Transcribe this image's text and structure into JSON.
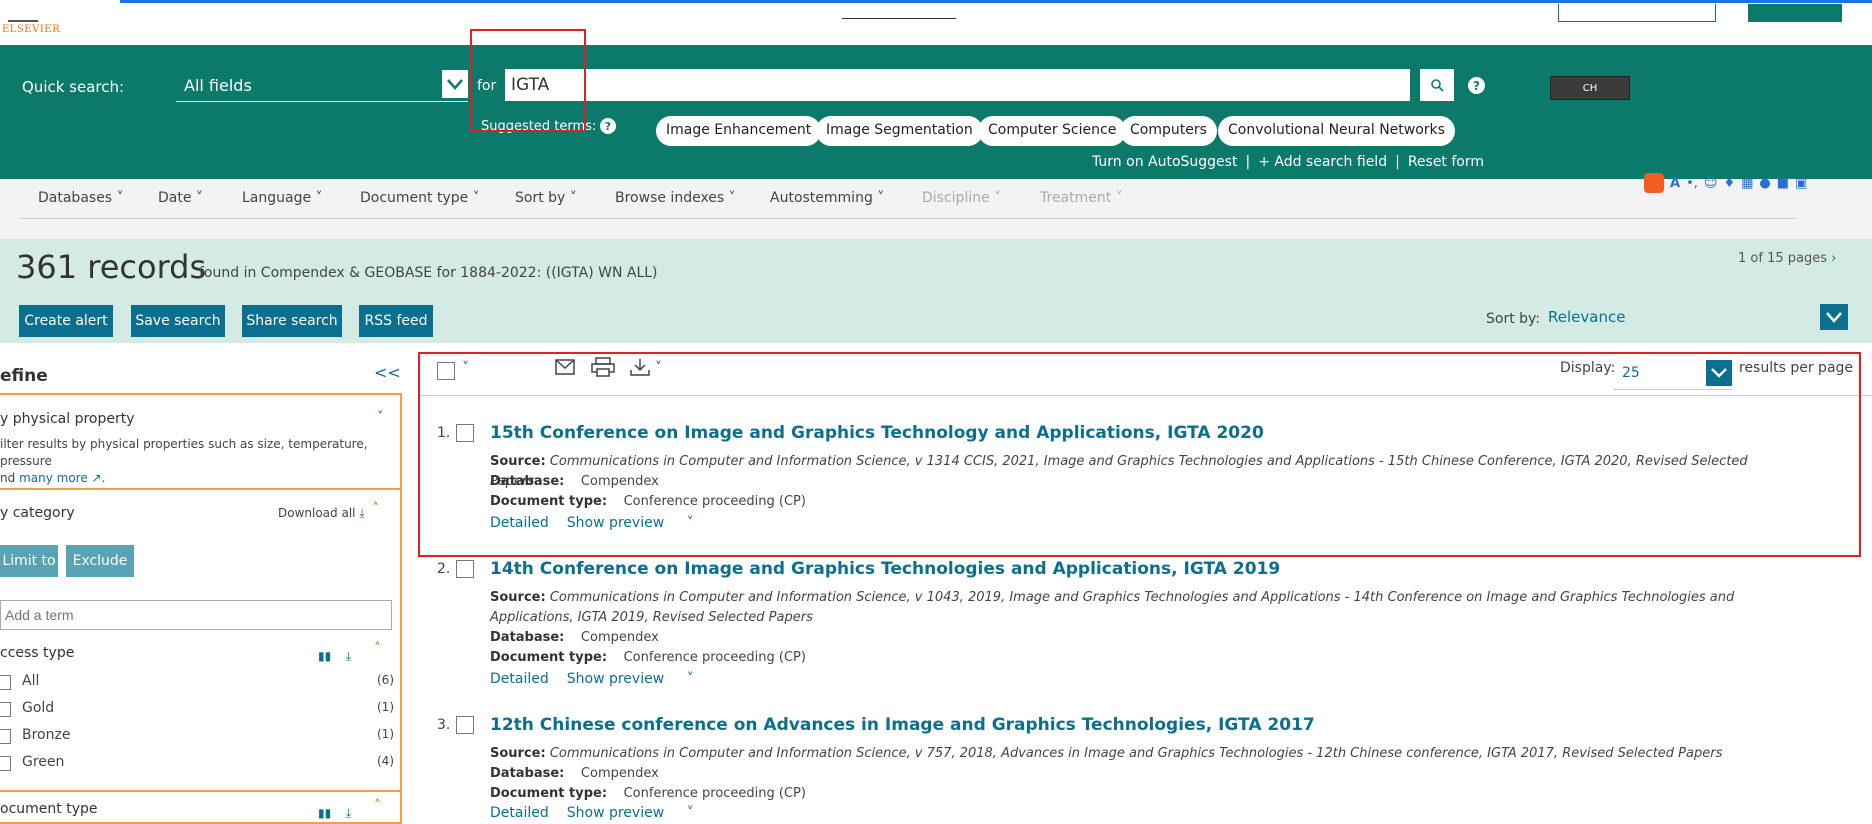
{
  "logo": {
    "text": "ELSEVIER"
  },
  "quick_search": {
    "label": "Quick search:",
    "field": "All fields",
    "for_label": "for",
    "query": "IGTA",
    "help": "?"
  },
  "suggested": {
    "label": "Suggested terms:",
    "terms": [
      "Image Enhancement",
      "Image Segmentation",
      "Computer Science",
      "Computers",
      "Convolutional Neural Networks"
    ]
  },
  "search_links": {
    "autosuggest": "Turn on AutoSuggest",
    "sep": "|",
    "add_field": "+ Add search field",
    "reset": "Reset form"
  },
  "ime_widget": {
    "label": "CH"
  },
  "nav": {
    "items": [
      "Databases",
      "Date",
      "Language",
      "Document type",
      "Sort by",
      "Browse indexes",
      "Autostemming"
    ],
    "disabled": [
      "Discipline",
      "Treatment"
    ]
  },
  "results_header": {
    "count": "361 records",
    "found_text": "found in Compendex & GEOBASE for 1884-2022: ((IGTA) WN ALL)",
    "pages": "1 of 15 pages",
    "buttons": [
      "Create alert",
      "Save search",
      "Share search",
      "RSS feed"
    ],
    "sort_label": "Sort by:",
    "sort_value": "Relevance"
  },
  "sidebar": {
    "title": "efine",
    "collapse": "<<",
    "physical": {
      "title": "y physical property",
      "desc": "ilter results by physical properties such as size, temperature, pressure",
      "desc2": "nd",
      "more": "many more"
    },
    "category": {
      "title": "y category",
      "download_all": "Download all"
    },
    "limit_label": "Limit to",
    "exclude_label": "Exclude",
    "term_placeholder": "Add a term",
    "access": {
      "title": "ccess type",
      "items": [
        {
          "label": "All",
          "count": "(6)"
        },
        {
          "label": "Gold",
          "count": "(1)"
        },
        {
          "label": "Bronze",
          "count": "(1)"
        },
        {
          "label": "Green",
          "count": "(4)"
        }
      ]
    },
    "doctype": {
      "title": "ocument type"
    }
  },
  "toolbar": {
    "display_label": "Display:",
    "display_value": "25",
    "rpp_label": "results per page"
  },
  "results": [
    {
      "num": "1.",
      "title": "15th Conference on Image and Graphics Technology and Applications, IGTA 2020",
      "source_label": "Source:",
      "source": "Communications in Computer and Information Science, v 1314 CCIS, 2021, Image and Graphics Technologies and Applications - 15th Chinese Conference, IGTA 2020, Revised Selected Papers",
      "database_label": "Database:",
      "database": "Compendex",
      "doctype_label": "Document type:",
      "doctype": "Conference proceeding (CP)",
      "detailed": "Detailed",
      "preview": "Show preview"
    },
    {
      "num": "2.",
      "title": "14th Conference on Image and Graphics Technologies and Applications, IGTA 2019",
      "source_label": "Source:",
      "source": "Communications in Computer and Information Science, v 1043, 2019, Image and Graphics Technologies and Applications - 14th Conference on Image and Graphics Technologies and Applications, IGTA 2019, Revised Selected Papers",
      "database_label": "Database:",
      "database": "Compendex",
      "doctype_label": "Document type:",
      "doctype": "Conference proceeding (CP)",
      "detailed": "Detailed",
      "preview": "Show preview"
    },
    {
      "num": "3.",
      "title": "12th Chinese conference on Advances in Image and Graphics Technologies, IGTA 2017",
      "source_label": "Source:",
      "source": "Communications in Computer and Information Science, v 757, 2018, Advances in Image and Graphics Technologies - 12th Chinese conference, IGTA 2017, Revised Selected Papers",
      "database_label": "Database:",
      "database": "Compendex",
      "doctype_label": "Document type:",
      "doctype": "Conference proceeding (CP)",
      "detailed": "Detailed",
      "preview": "Show preview"
    }
  ],
  "colors": {
    "brand_green": "#0b7a6b",
    "link_blue": "#0b6f8f",
    "results_band": "#d4ebe4",
    "annotation_red": "#e02020",
    "sidebar_orange": "#f0a040"
  }
}
